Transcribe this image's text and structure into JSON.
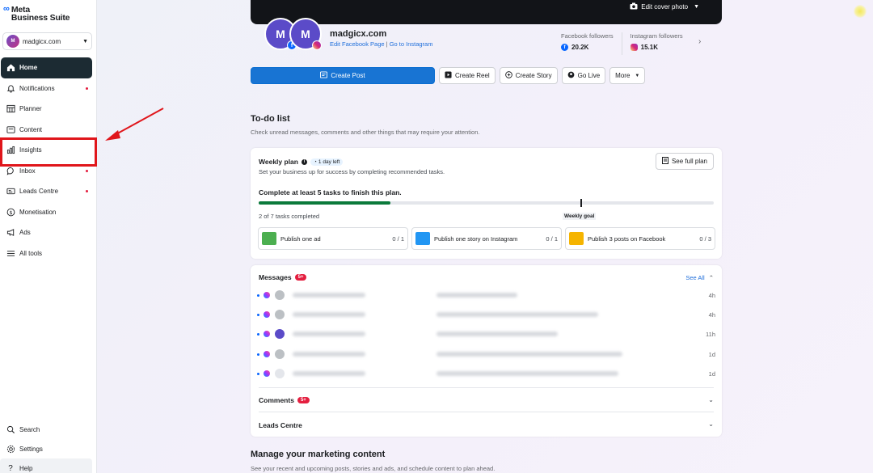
{
  "app": {
    "brand_line1": "Meta",
    "brand_line2": "Business Suite"
  },
  "account": {
    "name": "madgicx.com"
  },
  "sidebar": {
    "items": [
      {
        "label": "Home",
        "icon": "home-icon",
        "active": true
      },
      {
        "label": "Notifications",
        "icon": "bell-icon",
        "dot": true
      },
      {
        "label": "Planner",
        "icon": "calendar-grid-icon"
      },
      {
        "label": "Content",
        "icon": "content-icon"
      },
      {
        "label": "Insights",
        "icon": "bar-chart-icon"
      },
      {
        "label": "Inbox",
        "icon": "chat-bubble-icon",
        "dot": true
      },
      {
        "label": "Leads Centre",
        "icon": "leads-icon",
        "dot": true
      },
      {
        "label": "Monetisation",
        "icon": "dollar-icon"
      },
      {
        "label": "Ads",
        "icon": "megaphone-icon"
      },
      {
        "label": "All tools",
        "icon": "menu-icon"
      }
    ],
    "bottom": [
      {
        "label": "Search",
        "icon": "search-icon"
      },
      {
        "label": "Settings",
        "icon": "gear-icon"
      },
      {
        "label": "Help",
        "icon": "help-icon"
      }
    ]
  },
  "cover": {
    "edit_label": "Edit cover photo"
  },
  "profile": {
    "name": "madgicx.com",
    "edit_fb": "Edit Facebook Page",
    "separator": "|",
    "go_ig": "Go to Instagram",
    "fb_followers_label": "Facebook followers",
    "fb_followers": "20.2K",
    "ig_followers_label": "Instagram followers",
    "ig_followers": "15.1K"
  },
  "actions": {
    "create_post": "Create Post",
    "create_reel": "Create Reel",
    "create_story": "Create Story",
    "go_live": "Go Live",
    "more": "More"
  },
  "todo": {
    "title": "To-do list",
    "subtitle": "Check unread messages, comments and other things that may require your attention."
  },
  "weekly_plan": {
    "title": "Weekly plan",
    "pill": "1 day left",
    "subtitle": "Set your business up for success by completing recommended tasks.",
    "see_full": "See full plan",
    "goal_text": "Complete at least 5 tasks to finish this plan.",
    "completed_text": "2 of 7 tasks completed",
    "progress": 0.29,
    "goal_label": "Weekly goal",
    "tasks": [
      {
        "label": "Publish one ad",
        "count": "0 / 1",
        "color": "#4caf50"
      },
      {
        "label": "Publish one story on Instagram",
        "count": "0 / 1",
        "color": "#2196f3"
      },
      {
        "label": "Publish 3 posts on Facebook",
        "count": "0 / 3",
        "color": "#f5b400"
      }
    ]
  },
  "messages": {
    "title": "Messages",
    "badge": "5+",
    "see_all": "See All",
    "rows": [
      {
        "time": "4h"
      },
      {
        "time": "4h"
      },
      {
        "time": "11h"
      },
      {
        "time": "1d"
      },
      {
        "time": "1d"
      }
    ]
  },
  "comments": {
    "title": "Comments",
    "badge": "5+"
  },
  "leads": {
    "title": "Leads Centre"
  },
  "marketing": {
    "title": "Manage your marketing content",
    "subtitle": "See your recent and upcoming posts, stories and ads, and schedule content to plan ahead."
  },
  "colors": {
    "accent": "#1874d3",
    "nav_active": "#1c2b33",
    "highlight": "#e0161b",
    "progress": "#0b7a3b"
  }
}
